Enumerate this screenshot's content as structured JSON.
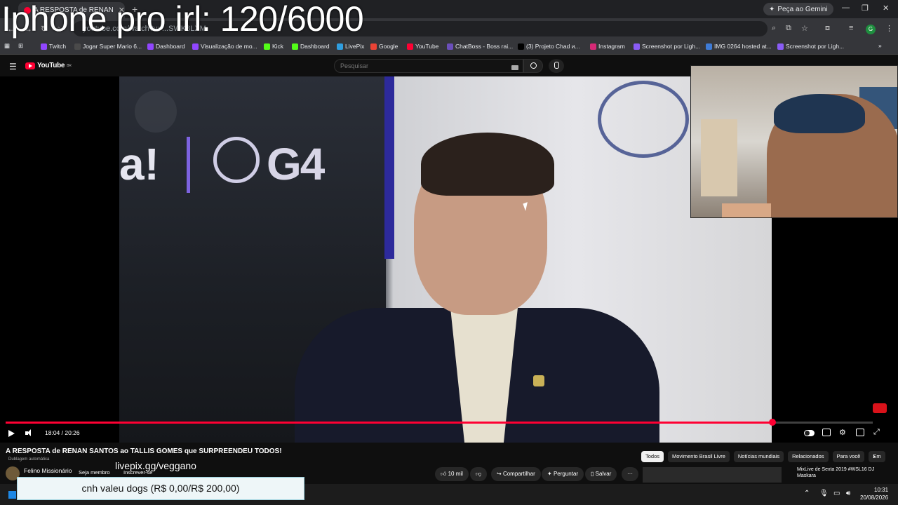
{
  "overlay": {
    "stream_title": "Iphone pro irl: 120/6000",
    "livepix_url": "livepix.gg/veggano",
    "donation": "cnh valeu dogs (R$ 0,00/R$ 200,00)"
  },
  "browser": {
    "tab_title": "A RESPOSTA de RENAN SANTOS",
    "gemini_label": "Peça ao Gemini",
    "url": "youtube.com/watch?v=...SWK8LXM",
    "avatar_letter": "G",
    "bookmarks": [
      {
        "label": "Twitch",
        "color": "#9146ff"
      },
      {
        "label": "Jogar Super Mario 6...",
        "color": "#4a4a4a"
      },
      {
        "label": "Dashboard",
        "color": "#9146ff"
      },
      {
        "label": "Visualização de mo...",
        "color": "#9146ff"
      },
      {
        "label": "Kick",
        "color": "#53fc18"
      },
      {
        "label": "Dashboard",
        "color": "#53fc18"
      },
      {
        "label": "LivePix",
        "color": "#2f9ee0"
      },
      {
        "label": "Google",
        "color": "#ea4335"
      },
      {
        "label": "YouTube",
        "color": "#ff0033"
      },
      {
        "label": "ChatBoss - Boss rai...",
        "color": "#6b4fbb"
      },
      {
        "label": "(3) Projeto Chad и...",
        "color": "#000000"
      },
      {
        "label": "Instagram",
        "color": "#d62976"
      },
      {
        "label": "Screenshot por Ligh...",
        "color": "#8a5cf6"
      },
      {
        "label": "IMG 0264 hosted at...",
        "color": "#3e7bd6"
      },
      {
        "label": "Screenshot por Ligh...",
        "color": "#8a5cf6"
      }
    ]
  },
  "youtube": {
    "logo": "YouTube",
    "logo_region": "BR",
    "search_placeholder": "Pesquisar",
    "video_title": "A RESPOSTA de RENAN SANTOS ao TALLIS GOMES que SURPREENDEU TODOS!",
    "dubbing": "Dublagem automática",
    "channel_name": "Felino Missionário",
    "member_label": "Seja membro",
    "subscribe_label": "Inscrever-se",
    "likes": "10 mil",
    "share_label": "Compartilhar",
    "ask_label": "Perguntar",
    "save_label": "Salvar",
    "time_display": "18:04 / 20:26",
    "progress_fraction": 0.8842,
    "chips": [
      "Todos",
      "Movimento Brasil Livre",
      "Notícias mundiais",
      "Relacionados",
      "Para você",
      "Em"
    ],
    "rec_title": "MixLive de Sexta 2019 #WSL16 DJ Maskara"
  },
  "video_content": {
    "logo_text": "G4",
    "exclaim": "a!"
  },
  "taskbar": {
    "time": "10:31",
    "date": "20/08/2026"
  }
}
